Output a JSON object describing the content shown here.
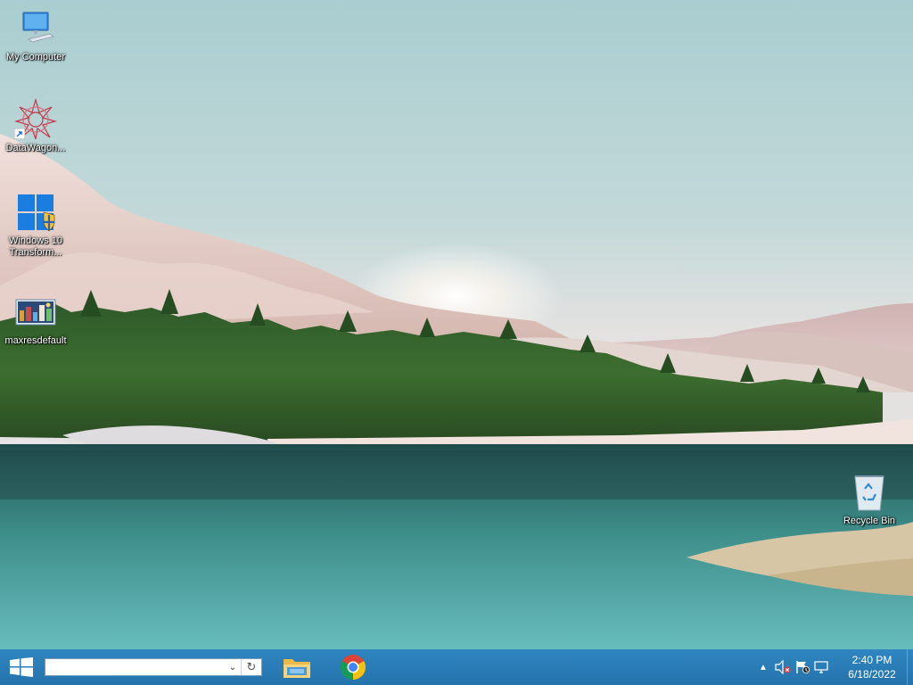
{
  "desktop": {
    "icons": [
      {
        "label": "My Computer"
      },
      {
        "label": "DataWagon..."
      },
      {
        "label": "Windows 10 Transform..."
      },
      {
        "label": "maxresdefault"
      },
      {
        "label": "Recycle Bin"
      }
    ]
  },
  "taskbar": {
    "address_value": "",
    "apps": [
      {
        "icon": "file-explorer-icon"
      },
      {
        "icon": "chrome-icon"
      }
    ],
    "tray": {
      "icons": [
        "show-hidden-icons-chevron",
        "volume-muted-icon",
        "action-center-flag-icon",
        "network-icon"
      ]
    },
    "clock": {
      "time": "2:40 PM",
      "date": "6/18/2022"
    }
  },
  "colors": {
    "taskbar": "#2a7bb5",
    "accent": "#0078d7"
  }
}
